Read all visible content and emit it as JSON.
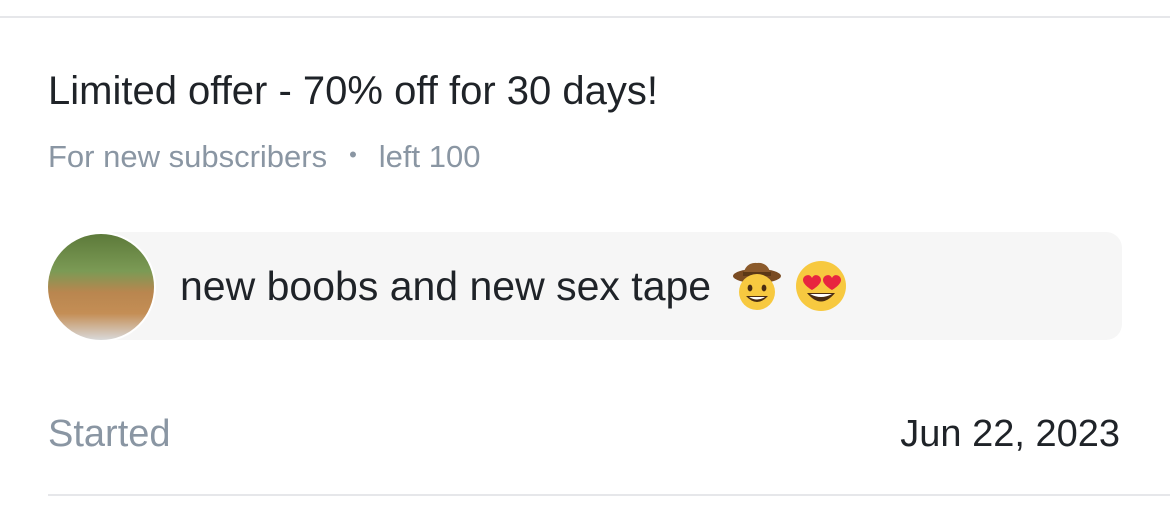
{
  "offer": {
    "title": "Limited offer - 70% off for 30 days!",
    "audience": "For new subscribers",
    "separator": "•",
    "remaining": "left 100"
  },
  "message": {
    "text": "new boobs and new sex tape",
    "emojis": [
      "cowboy-face-emoji",
      "heart-eyes-emoji"
    ]
  },
  "started": {
    "label": "Started",
    "date": "Jun 22, 2023"
  }
}
